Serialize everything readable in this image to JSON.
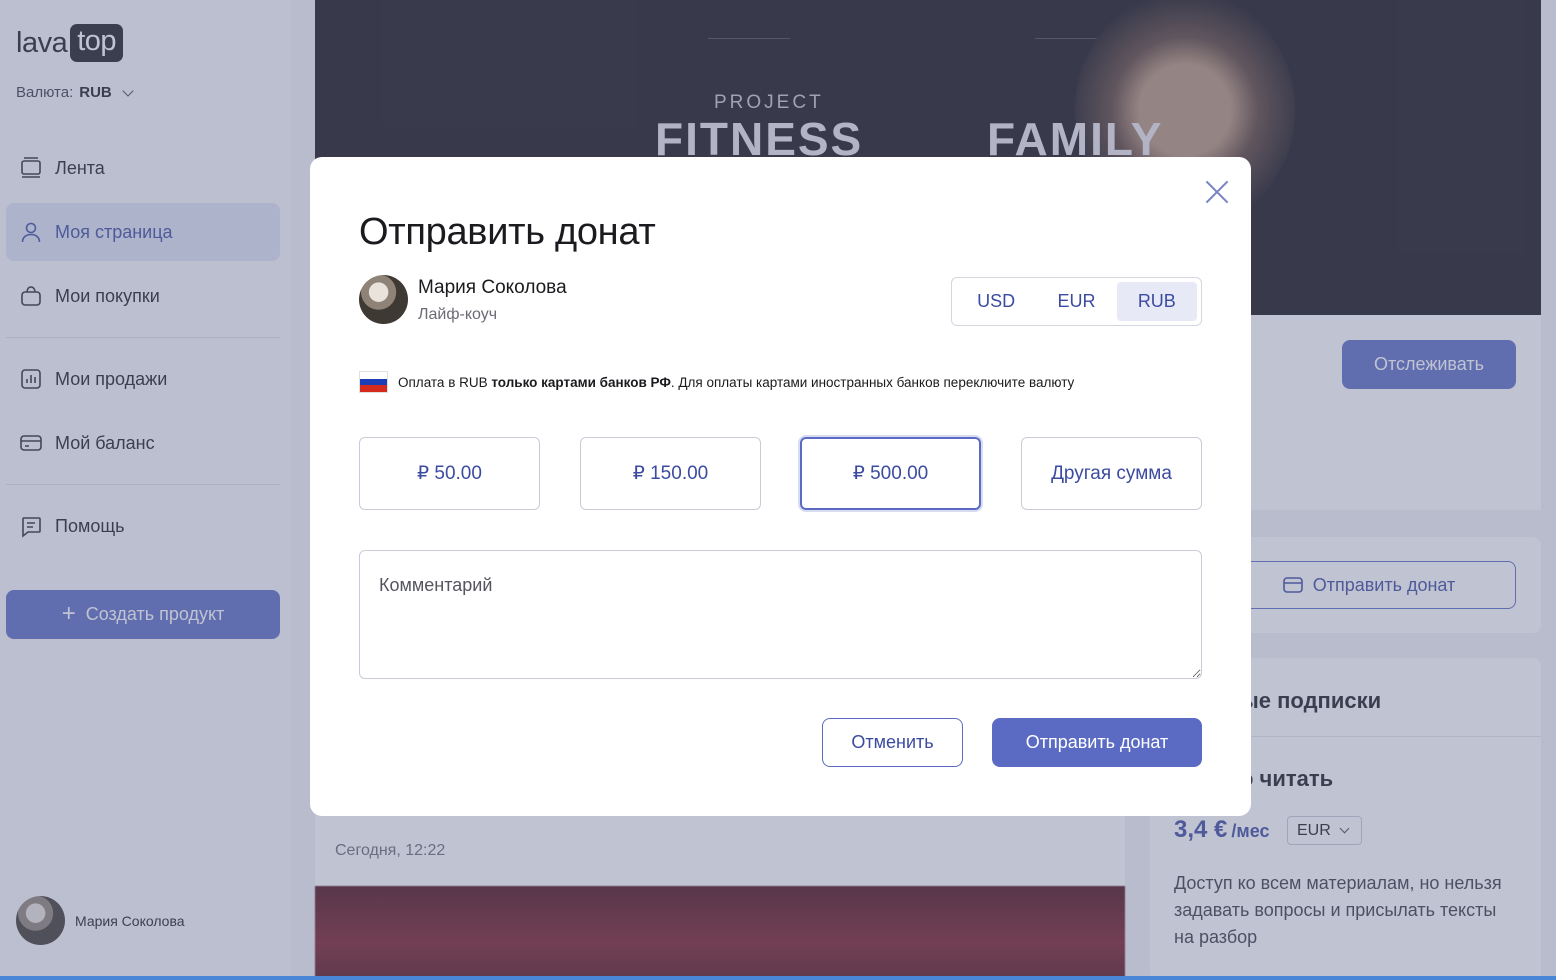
{
  "logo": {
    "left": "lava",
    "right": "top"
  },
  "sidebar": {
    "currency_label": "Валюта:",
    "currency_value": "RUB",
    "items": [
      {
        "label": "Лента",
        "icon": "feed-icon"
      },
      {
        "label": "Моя страница",
        "icon": "user-icon"
      },
      {
        "label": "Мои покупки",
        "icon": "bag-icon"
      },
      {
        "label": "Мои продажи",
        "icon": "chart-icon"
      },
      {
        "label": "Мой баланс",
        "icon": "wallet-icon"
      },
      {
        "label": "Помощь",
        "icon": "chat-icon"
      }
    ],
    "create_button": "Создать продукт",
    "user_name": "Мария Соколова"
  },
  "banner": {
    "line1": "PROJECT",
    "word1": "FITNESS",
    "word2": "FAMILY"
  },
  "right_panel": {
    "follow_button": "Отслеживать",
    "donate_button": "Отправить донат",
    "subscriptions_title": "ые подписки",
    "plan_title": "о читать",
    "price": "3,4 €",
    "price_period": "/мес",
    "price_currency": "EUR",
    "plan_description": "Доступ ко всем материалам, но нельзя задавать вопросы и присылать тексты на разбор"
  },
  "post": {
    "date": "Сегодня, 12:22"
  },
  "modal": {
    "title": "Отправить донат",
    "author_name": "Мария Соколова",
    "author_role": "Лайф-коуч",
    "currencies": [
      "USD",
      "EUR",
      "RUB"
    ],
    "selected_currency": "RUB",
    "notice_prefix": "Оплата в RUB ",
    "notice_bold": "только картами банков РФ",
    "notice_suffix": ". Для оплаты картами иностранных банков переключите валюту",
    "amounts": [
      "₽ 50.00",
      "₽ 150.00",
      "₽ 500.00",
      "Другая сумма"
    ],
    "selected_amount": "₽ 500.00",
    "comment_placeholder": "Комментарий",
    "cancel_button": "Отменить",
    "submit_button": "Отправить донат"
  },
  "colors": {
    "accent": "#5b6bc4",
    "accent_text": "#3b4ba0"
  }
}
